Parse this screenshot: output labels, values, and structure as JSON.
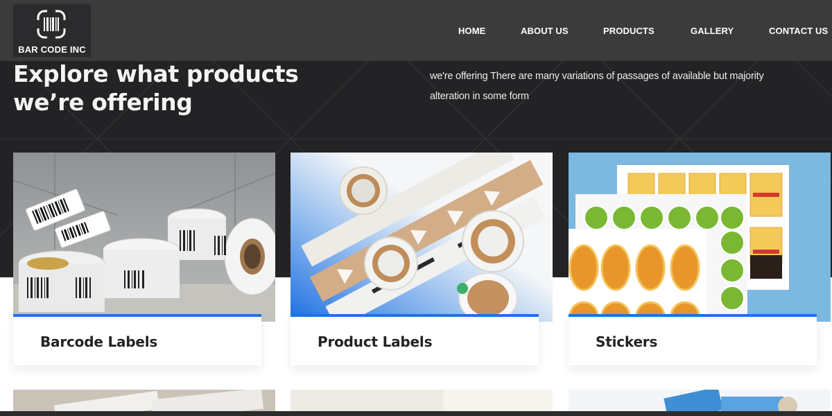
{
  "brand": {
    "name": "BAR CODE INC",
    "logo_icon": "barcode-icon"
  },
  "nav": {
    "items": [
      {
        "label": "HOME"
      },
      {
        "label": "ABOUT US"
      },
      {
        "label": "PRODUCTS"
      },
      {
        "label": "GALLERY"
      },
      {
        "label": "CONTACT US"
      }
    ]
  },
  "section": {
    "title": "Explore what products we’re offering",
    "intro": "we're offering There are many variations of passages of available but majority alteration in some form"
  },
  "products": [
    {
      "label": "Barcode Labels"
    },
    {
      "label": "Product Labels"
    },
    {
      "label": "Stickers"
    }
  ],
  "colors": {
    "header": "#3b3b3c",
    "hero": "#232325",
    "accent": "#1a73e8"
  }
}
